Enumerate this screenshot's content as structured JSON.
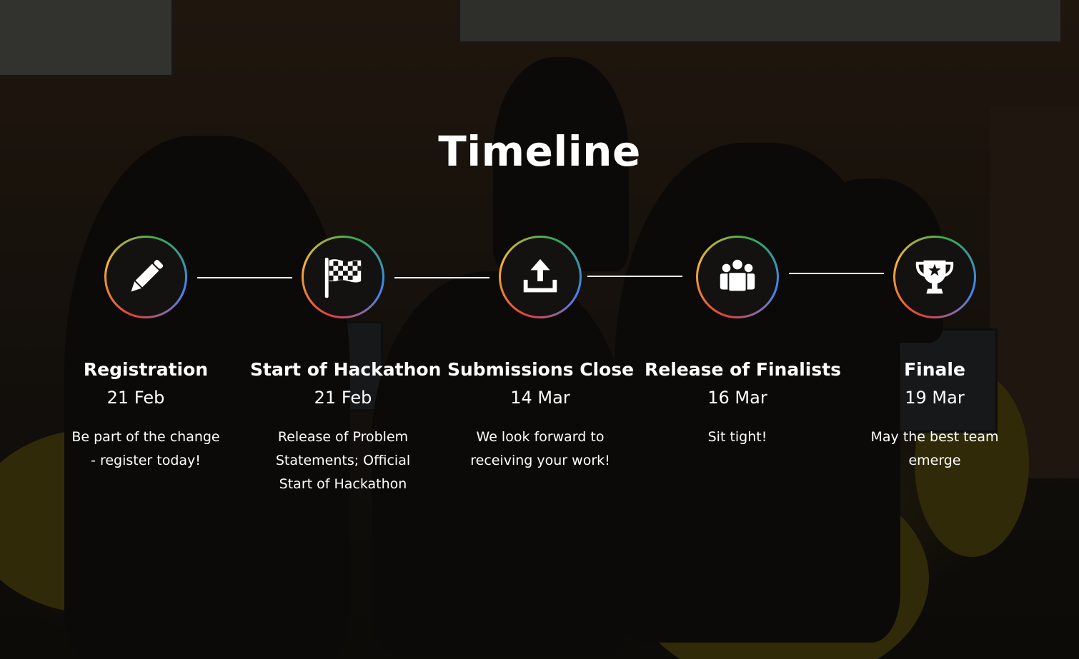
{
  "heading": "Timeline",
  "colors": {
    "ring_red": "#e2413b",
    "ring_yellow": "#f2b43a",
    "ring_green": "#34a853",
    "ring_blue": "#4285f4",
    "text": "#ffffff"
  },
  "steps": [
    {
      "icon": "pencil-icon",
      "title": "Registration",
      "date": "21 Feb",
      "description": "Be part of the change - register today!"
    },
    {
      "icon": "checkered-flag-icon",
      "title": "Start of Hackathon",
      "date": "21 Feb",
      "description": "Release of Problem Statements; Official Start of Hackathon"
    },
    {
      "icon": "upload-icon",
      "title": "Submissions Close",
      "date": "14 Mar",
      "description": "We look forward to receiving your work!"
    },
    {
      "icon": "group-icon",
      "title": "Release of Finalists",
      "date": "16 Mar",
      "description": "Sit tight!"
    },
    {
      "icon": "trophy-icon",
      "title": "Finale",
      "date": "19 Mar",
      "description": "May the best team emerge"
    }
  ]
}
